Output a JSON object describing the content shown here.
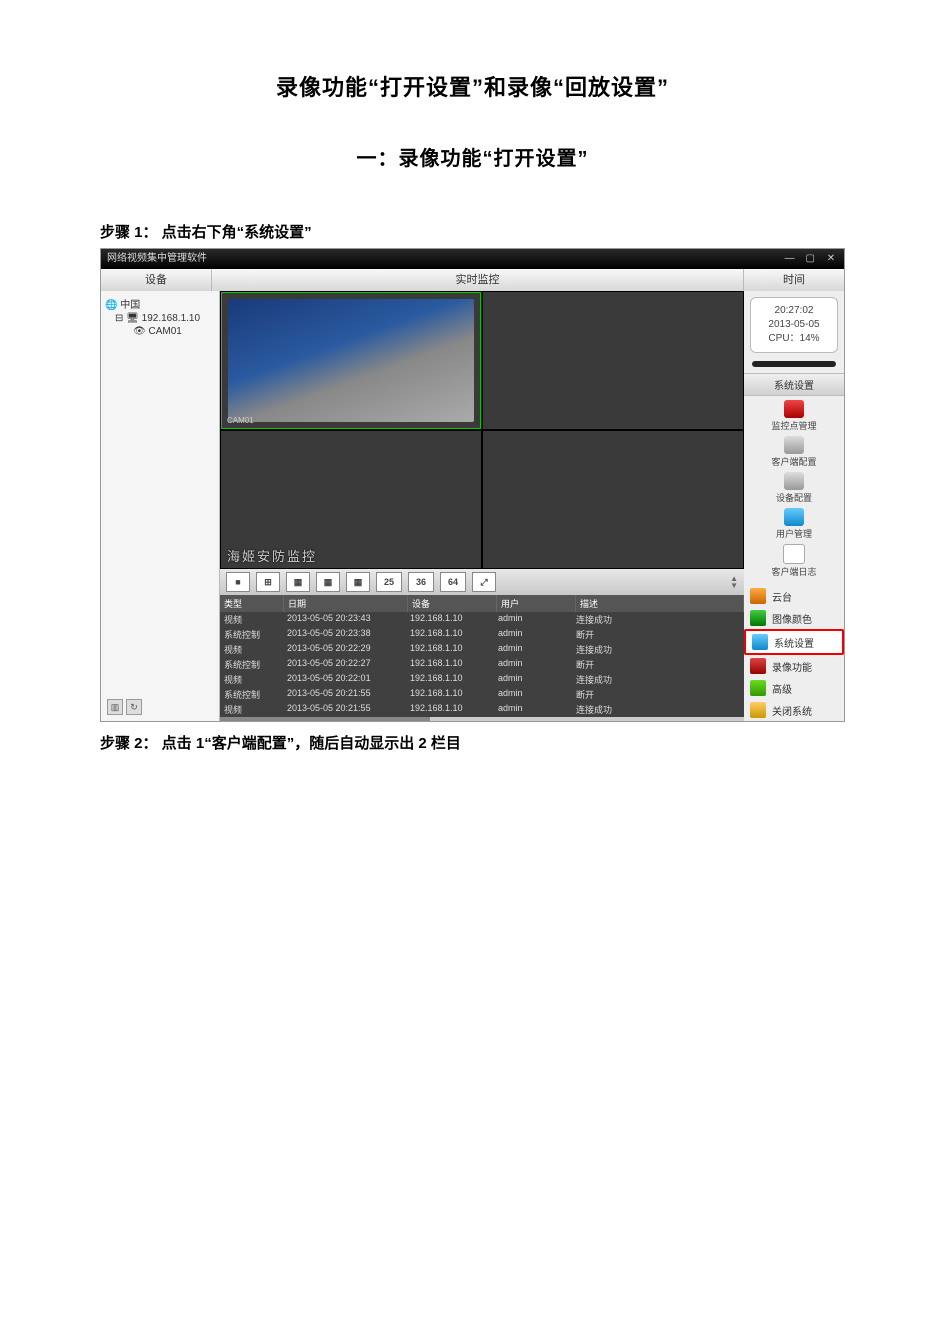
{
  "doc": {
    "title": "录像功能“打开设置”和录像“回放设置”",
    "subtitle": "一：录像功能“打开设置”",
    "step1": "步骤 1：  点击右下角“系统设置”",
    "step2": "步骤 2：  点击 1“客户端配置”，随后自动显示出 2 栏目"
  },
  "app": {
    "title": "网络视频集中管理软件",
    "tabs": {
      "left": "设备",
      "mid": "实时监控",
      "right": "时间"
    },
    "tree": {
      "root": "中国",
      "ip": "192.168.1.10",
      "cam": "CAM01"
    },
    "video": {
      "watermark": "海姬安防监控",
      "cam_label": "CAM01"
    },
    "toolbar": {
      "b1": "■",
      "b4": "⊞",
      "b9": "▦",
      "b16": "▦",
      "b25n": "25",
      "b36n": "36",
      "b64n": "64",
      "bfs": "⤢"
    },
    "clock": {
      "time": "20:27:02",
      "date": "2013-05-05",
      "cpu": "CPU：14%"
    },
    "sections": {
      "settings": "系统设置"
    },
    "settings_items": [
      {
        "label": "监控点管理",
        "cls": "hi-red"
      },
      {
        "label": "客户端配置",
        "cls": "hi-gray"
      },
      {
        "label": "设备配置",
        "cls": "hi-gray"
      },
      {
        "label": "用户管理",
        "cls": "hi-blue"
      },
      {
        "label": "客户端日志",
        "cls": "hi-doc"
      }
    ],
    "right_items": [
      {
        "label": "云台",
        "cls": "hi-orange"
      },
      {
        "label": "图像颜色",
        "cls": "hi-green"
      },
      {
        "label": "系统设置",
        "cls": "hi-blue",
        "hl": true
      },
      {
        "label": "录像功能",
        "cls": "hi-film"
      },
      {
        "label": "高级",
        "cls": "hi-dl"
      },
      {
        "label": "关闭系统",
        "cls": "hi-ppl"
      }
    ],
    "log": {
      "headers": {
        "type": "类型",
        "date": "日期",
        "dev": "设备",
        "user": "用户",
        "desc": "描述"
      },
      "rows": [
        {
          "type": "视频",
          "date": "2013-05-05 20:23:43",
          "dev": "192.168.1.10",
          "user": "admin",
          "desc": "连接成功"
        },
        {
          "type": "系统控制",
          "date": "2013-05-05 20:23:38",
          "dev": "192.168.1.10",
          "user": "admin",
          "desc": "断开"
        },
        {
          "type": "视频",
          "date": "2013-05-05 20:22:29",
          "dev": "192.168.1.10",
          "user": "admin",
          "desc": "连接成功"
        },
        {
          "type": "系统控制",
          "date": "2013-05-05 20:22:27",
          "dev": "192.168.1.10",
          "user": "admin",
          "desc": "断开"
        },
        {
          "type": "视频",
          "date": "2013-05-05 20:22:01",
          "dev": "192.168.1.10",
          "user": "admin",
          "desc": "连接成功"
        },
        {
          "type": "系统控制",
          "date": "2013-05-05 20:21:55",
          "dev": "192.168.1.10",
          "user": "admin",
          "desc": "断开"
        },
        {
          "type": "视频",
          "date": "2013-05-05 20:21:55",
          "dev": "192.168.1.10",
          "user": "admin",
          "desc": "连接成功"
        }
      ]
    }
  }
}
